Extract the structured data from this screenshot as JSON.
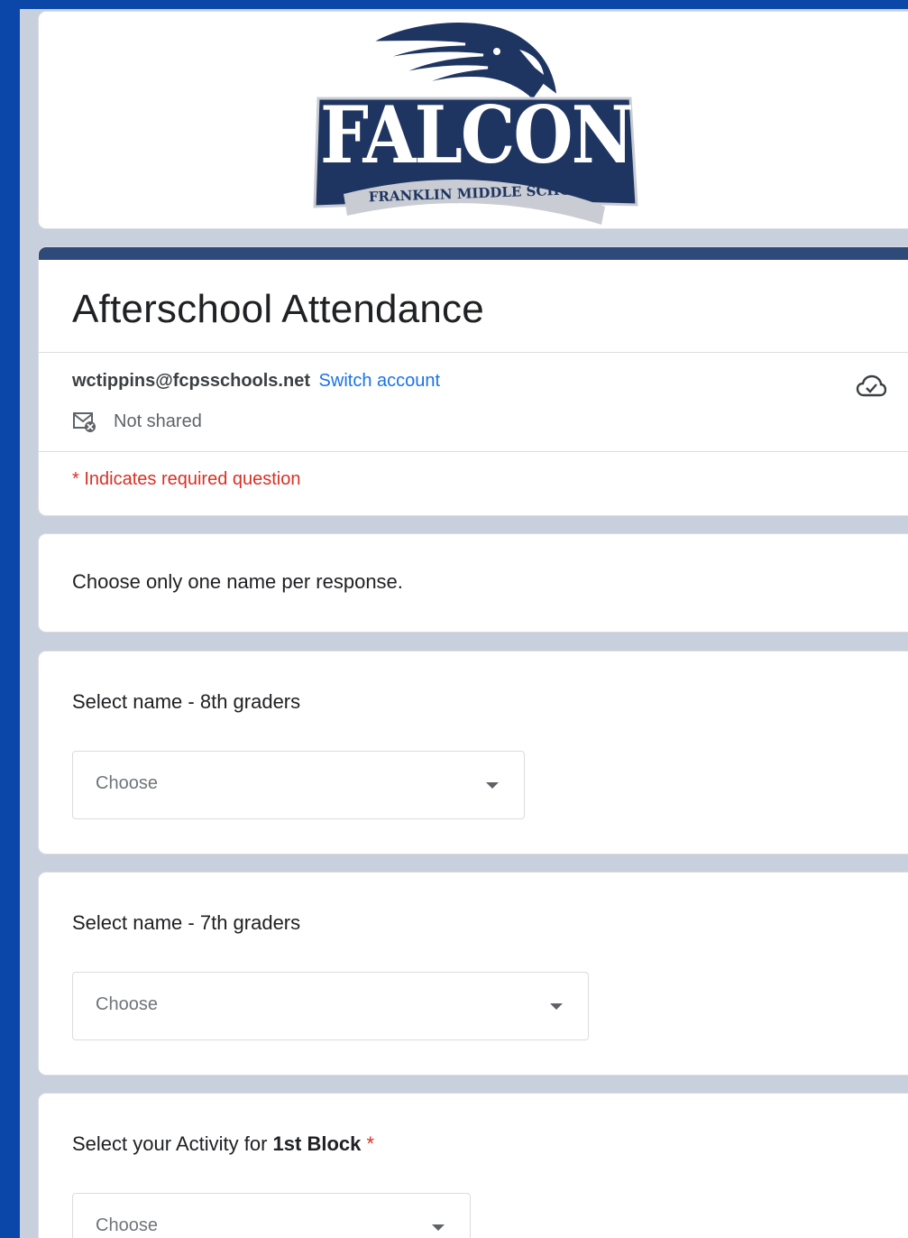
{
  "colors": {
    "outer_bg": "#0a47a9",
    "page_bg": "#c8d0dd",
    "theme_bar": "#2f4a7a",
    "link": "#1a73e8",
    "required": "#d93025",
    "logo_navy": "#1f3561"
  },
  "header": {
    "logo_text": "FALCONS",
    "logo_subtext": "FRANKLIN MIDDLE SCHOOL"
  },
  "form": {
    "title": "Afterschool Attendance",
    "account_email": "wctippins@fcpsschools.net",
    "switch_account_label": "Switch account",
    "cloud_icon": "cloud-check-icon",
    "shared_icon": "mail-not-shared-icon",
    "shared_status": "Not shared",
    "required_note": "* Indicates required question"
  },
  "instructions": {
    "text": "Choose only one name per response."
  },
  "questions": [
    {
      "label": "Select name - 8th graders",
      "placeholder": "Choose",
      "required": false
    },
    {
      "label": "Select name - 7th graders",
      "placeholder": "Choose",
      "required": false
    },
    {
      "label_prefix": "Select your Activity for ",
      "label_bold": "1st Block",
      "required_mark": "*",
      "placeholder": "Choose",
      "required": true
    }
  ]
}
